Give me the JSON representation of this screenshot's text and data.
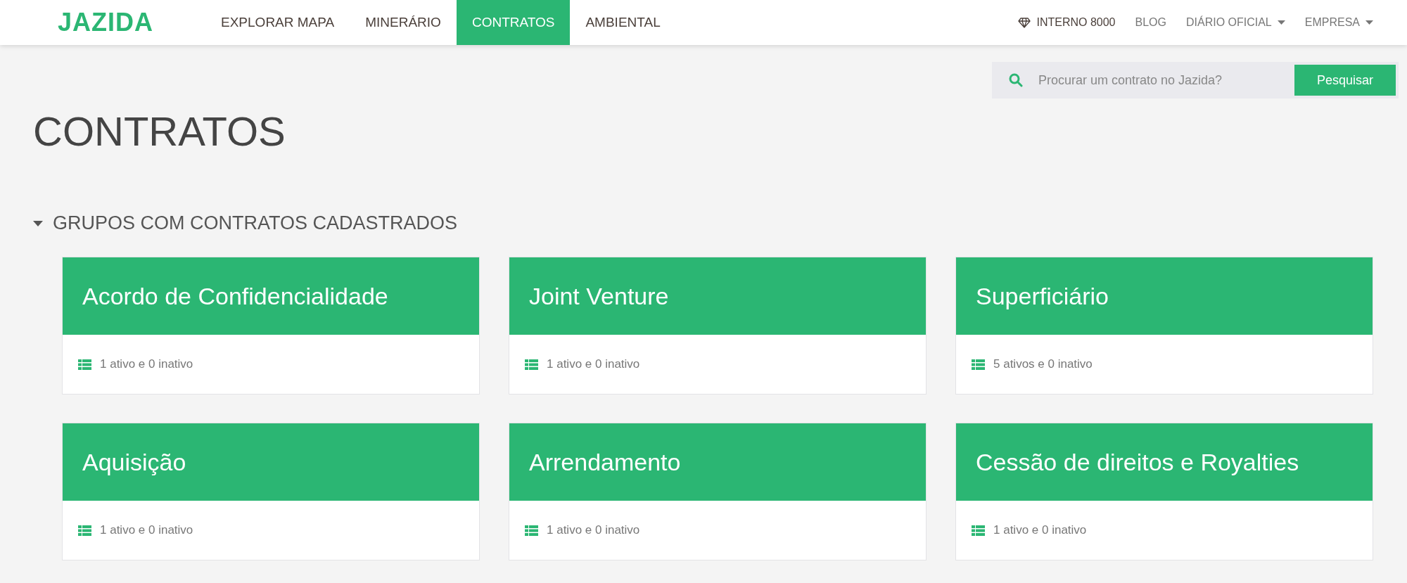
{
  "logo": "JAZIDA",
  "nav": {
    "items": [
      {
        "label": "EXPLORAR MAPA",
        "selected": false
      },
      {
        "label": "MINERÁRIO",
        "selected": false
      },
      {
        "label": "CONTRATOS",
        "selected": true
      },
      {
        "label": "AMBIENTAL",
        "selected": false
      }
    ],
    "right": [
      {
        "label": "INTERNO 8000",
        "kind": "gem"
      },
      {
        "label": "BLOG",
        "kind": "plain"
      },
      {
        "label": "DIÁRIO OFICIAL",
        "kind": "dropdown"
      },
      {
        "label": "EMPRESA",
        "kind": "dropdown"
      }
    ]
  },
  "search": {
    "placeholder": "Procurar um contrato no Jazida?",
    "button": "Pesquisar"
  },
  "page_title": "CONTRATOS",
  "section": {
    "title": "GRUPOS COM CONTRATOS CADASTRADOS",
    "expanded": true
  },
  "groups": [
    {
      "name": "Acordo de Confidencialidade",
      "summary": "1 ativo e 0 inativo"
    },
    {
      "name": "Joint Venture",
      "summary": "1 ativo e 0 inativo"
    },
    {
      "name": "Superficiário",
      "summary": "5 ativos e 0 inativo"
    },
    {
      "name": "Aquisição",
      "summary": "1 ativo e 0 inativo"
    },
    {
      "name": "Arrendamento",
      "summary": "1 ativo e 0 inativo"
    },
    {
      "name": "Cessão de direitos e Royalties",
      "summary": "1 ativo e 0 inativo"
    }
  ]
}
